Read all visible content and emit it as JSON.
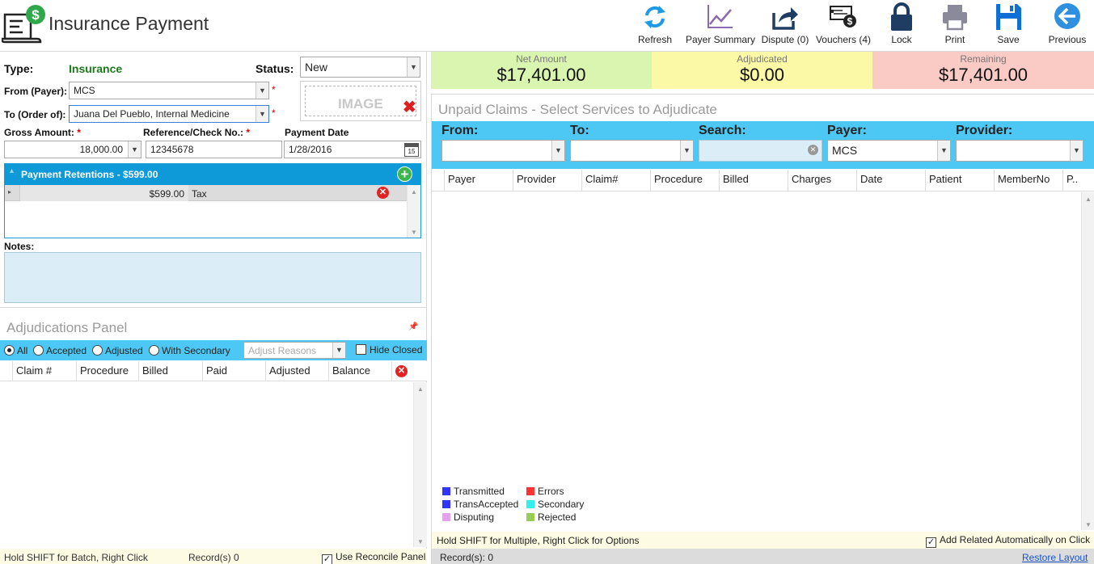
{
  "app": {
    "title": "Insurance Payment"
  },
  "toolbar": [
    {
      "label": "Refresh",
      "icon": "refresh-icon"
    },
    {
      "label": "Payer Summary",
      "icon": "chart-line-icon"
    },
    {
      "label": "Dispute (0)",
      "icon": "share-arrow-icon"
    },
    {
      "label": "Vouchers (4)",
      "icon": "voucher-icon"
    },
    {
      "label": "Lock",
      "icon": "lock-icon"
    },
    {
      "label": "Print",
      "icon": "printer-icon"
    },
    {
      "label": "Save",
      "icon": "floppy-disk-icon"
    },
    {
      "label": "Previous",
      "icon": "arrow-left-icon"
    }
  ],
  "payment": {
    "type_label": "Type:",
    "type_value": "Insurance",
    "status_label": "Status:",
    "status_value": "New",
    "from_label": "From (Payer):",
    "from_value": "MCS",
    "to_label": "To (Order of):",
    "to_value": "Juana Del Pueblo, Internal Medicine",
    "required_mark": "*",
    "image_label": "IMAGE",
    "gross_label": "Gross Amount:",
    "gross_value": "18,000.00",
    "ref_label": "Reference/Check No.:",
    "ref_value": "12345678",
    "date_label": "Payment Date",
    "date_value": "1/28/2016",
    "calendar_day": "15"
  },
  "retentions": {
    "title": "Payment Retentions - $599.00",
    "rows": [
      {
        "amount": "$599.00",
        "type": "Tax"
      }
    ]
  },
  "notes": {
    "label": "Notes:",
    "value": ""
  },
  "adjudications": {
    "title": "Adjudications Panel",
    "filters": [
      "All",
      "Accepted",
      "Adjusted",
      "With Secondary"
    ],
    "selected_filter": "All",
    "adjust_reasons_placeholder": "Adjust Reasons",
    "hide_closed_label": "Hide Closed",
    "columns": [
      "Claim #",
      "Procedure",
      "Billed",
      "Paid",
      "Adjusted",
      "Balance"
    ],
    "status_hint": "Hold SHIFT for Batch, Right Click",
    "records": "Record(s) 0",
    "reconcile_label": "Use Reconcile Panel"
  },
  "summary": {
    "net_label": "Net Amount",
    "net_value": "$17,401.00",
    "adj_label": "Adjudicated",
    "adj_value": "$0.00",
    "rem_label": "Remaining",
    "rem_value": "$17,401.00",
    "colors": {
      "net": "#d9f5b0",
      "adj": "#fbf8a6",
      "rem": "#f9cbc4"
    }
  },
  "claims": {
    "title": "Unpaid Claims - Select Services to Adjudicate",
    "filter_labels": {
      "from": "From:",
      "to": "To:",
      "search": "Search:",
      "payer": "Payer:",
      "provider": "Provider:"
    },
    "payer_value": "MCS",
    "columns": [
      "Payer",
      "Provider",
      "Claim#",
      "Procedure",
      "Billed",
      "Charges",
      "Date",
      "Patient",
      "MemberNo",
      "P.."
    ],
    "legend": [
      {
        "label": "Transmitted",
        "color": "#3333ff"
      },
      {
        "label": "Errors",
        "color": "#ff3333"
      },
      {
        "label": "TransAccepted",
        "color": "#3333ff"
      },
      {
        "label": "Secondary",
        "color": "#33eeee"
      },
      {
        "label": "Disputing",
        "color": "#e8a0f0"
      },
      {
        "label": "Rejected",
        "color": "#99cc55"
      }
    ],
    "status_hint": "Hold SHIFT for Multiple, Right Click for Options",
    "auto_related_label": "Add Related Automatically on Click",
    "records": "Record(s): 0",
    "restore_layout": "Restore Layout"
  }
}
